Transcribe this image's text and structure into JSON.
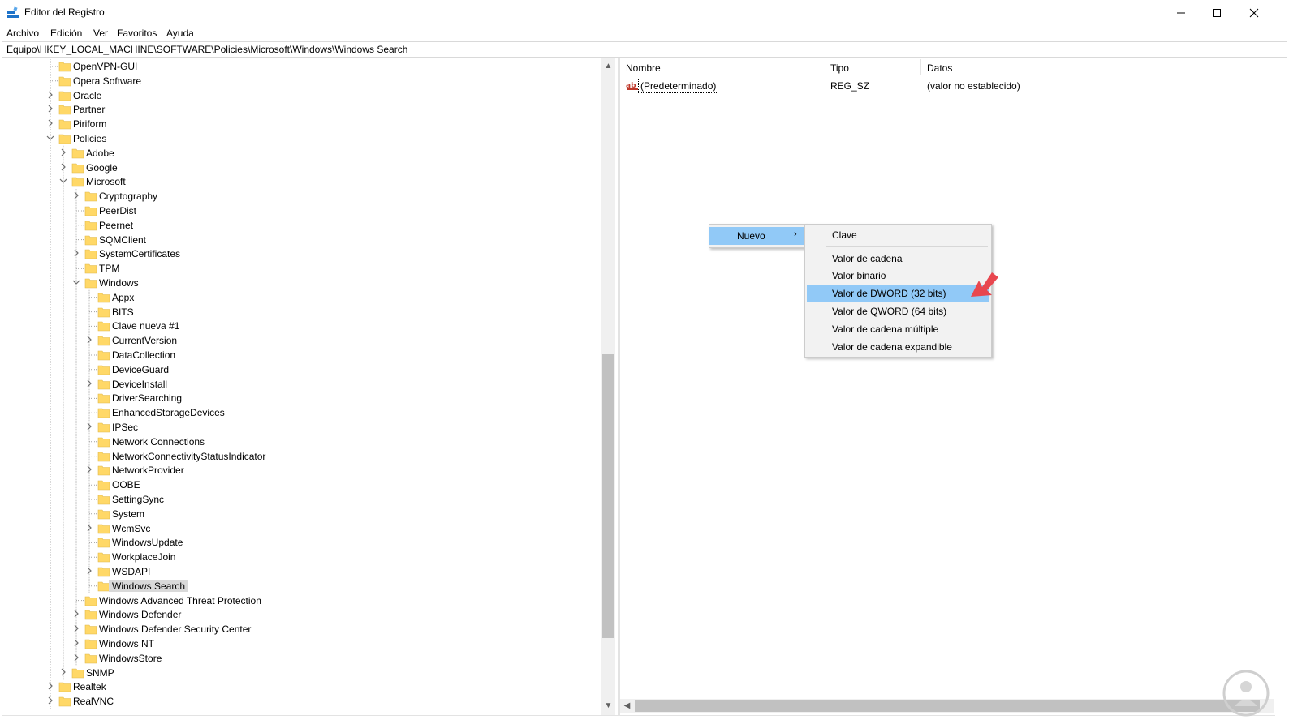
{
  "window": {
    "title": "Editor del Registro"
  },
  "menu": [
    "Archivo",
    "Edición",
    "Ver",
    "Favoritos",
    "Ayuda"
  ],
  "address": "Equipo\\HKEY_LOCAL_MACHINE\\SOFTWARE\\Policies\\Microsoft\\Windows\\Windows Search",
  "tree": [
    {
      "label": "OpenVPN-GUI",
      "depth": 0,
      "expander": "none",
      "selected": false
    },
    {
      "label": "Opera Software",
      "depth": 0,
      "expander": "none",
      "selected": false
    },
    {
      "label": "Oracle",
      "depth": 0,
      "expander": "collapsed",
      "selected": false
    },
    {
      "label": "Partner",
      "depth": 0,
      "expander": "collapsed",
      "selected": false
    },
    {
      "label": "Piriform",
      "depth": 0,
      "expander": "collapsed",
      "selected": false
    },
    {
      "label": "Policies",
      "depth": 0,
      "expander": "expanded",
      "selected": false
    },
    {
      "label": "Adobe",
      "depth": 1,
      "expander": "collapsed",
      "selected": false
    },
    {
      "label": "Google",
      "depth": 1,
      "expander": "collapsed",
      "selected": false
    },
    {
      "label": "Microsoft",
      "depth": 1,
      "expander": "expanded",
      "selected": false
    },
    {
      "label": "Cryptography",
      "depth": 2,
      "expander": "collapsed",
      "selected": false
    },
    {
      "label": "PeerDist",
      "depth": 2,
      "expander": "none",
      "selected": false
    },
    {
      "label": "Peernet",
      "depth": 2,
      "expander": "none",
      "selected": false
    },
    {
      "label": "SQMClient",
      "depth": 2,
      "expander": "none",
      "selected": false
    },
    {
      "label": "SystemCertificates",
      "depth": 2,
      "expander": "collapsed",
      "selected": false
    },
    {
      "label": "TPM",
      "depth": 2,
      "expander": "none",
      "selected": false
    },
    {
      "label": "Windows",
      "depth": 2,
      "expander": "expanded",
      "selected": false
    },
    {
      "label": "Appx",
      "depth": 3,
      "expander": "none",
      "selected": false
    },
    {
      "label": "BITS",
      "depth": 3,
      "expander": "none",
      "selected": false
    },
    {
      "label": "Clave nueva #1",
      "depth": 3,
      "expander": "none",
      "selected": false
    },
    {
      "label": "CurrentVersion",
      "depth": 3,
      "expander": "collapsed",
      "selected": false
    },
    {
      "label": "DataCollection",
      "depth": 3,
      "expander": "none",
      "selected": false
    },
    {
      "label": "DeviceGuard",
      "depth": 3,
      "expander": "none",
      "selected": false
    },
    {
      "label": "DeviceInstall",
      "depth": 3,
      "expander": "collapsed",
      "selected": false
    },
    {
      "label": "DriverSearching",
      "depth": 3,
      "expander": "none",
      "selected": false
    },
    {
      "label": "EnhancedStorageDevices",
      "depth": 3,
      "expander": "none",
      "selected": false
    },
    {
      "label": "IPSec",
      "depth": 3,
      "expander": "collapsed",
      "selected": false
    },
    {
      "label": "Network Connections",
      "depth": 3,
      "expander": "none",
      "selected": false
    },
    {
      "label": "NetworkConnectivityStatusIndicator",
      "depth": 3,
      "expander": "none",
      "selected": false
    },
    {
      "label": "NetworkProvider",
      "depth": 3,
      "expander": "collapsed",
      "selected": false
    },
    {
      "label": "OOBE",
      "depth": 3,
      "expander": "none",
      "selected": false
    },
    {
      "label": "SettingSync",
      "depth": 3,
      "expander": "none",
      "selected": false
    },
    {
      "label": "System",
      "depth": 3,
      "expander": "none",
      "selected": false
    },
    {
      "label": "WcmSvc",
      "depth": 3,
      "expander": "collapsed",
      "selected": false
    },
    {
      "label": "WindowsUpdate",
      "depth": 3,
      "expander": "none",
      "selected": false
    },
    {
      "label": "WorkplaceJoin",
      "depth": 3,
      "expander": "none",
      "selected": false
    },
    {
      "label": "WSDAPI",
      "depth": 3,
      "expander": "collapsed",
      "selected": false
    },
    {
      "label": "Windows Search",
      "depth": 3,
      "expander": "none",
      "selected": true
    },
    {
      "label": "Windows Advanced Threat Protection",
      "depth": 2,
      "expander": "none",
      "selected": false
    },
    {
      "label": "Windows Defender",
      "depth": 2,
      "expander": "collapsed",
      "selected": false
    },
    {
      "label": "Windows Defender Security Center",
      "depth": 2,
      "expander": "collapsed",
      "selected": false
    },
    {
      "label": "Windows NT",
      "depth": 2,
      "expander": "collapsed",
      "selected": false
    },
    {
      "label": "WindowsStore",
      "depth": 2,
      "expander": "collapsed",
      "selected": false
    },
    {
      "label": "SNMP",
      "depth": 1,
      "expander": "collapsed",
      "selected": false
    },
    {
      "label": "Realtek",
      "depth": 0,
      "expander": "collapsed",
      "selected": false
    },
    {
      "label": "RealVNC",
      "depth": 0,
      "expander": "collapsed",
      "selected": false
    }
  ],
  "list": {
    "columns": [
      "Nombre",
      "Tipo",
      "Datos"
    ],
    "rows": [
      {
        "name": "(Predeterminado)",
        "type": "REG_SZ",
        "data": "(valor no establecido)",
        "icon": "string-value-icon"
      }
    ]
  },
  "context_menu": {
    "item": "Nuevo",
    "submenu": [
      "Clave",
      "Valor de cadena",
      "Valor binario",
      "Valor de DWORD (32 bits)",
      "Valor de QWORD (64 bits)",
      "Valor de cadena múltiple",
      "Valor de cadena expandible"
    ],
    "highlighted": "Valor de DWORD (32 bits)"
  },
  "colors": {
    "highlight": "#91c9f7",
    "selection": "#d9d9d9",
    "folder": "#ffd867",
    "arrow": "#e8474f"
  }
}
